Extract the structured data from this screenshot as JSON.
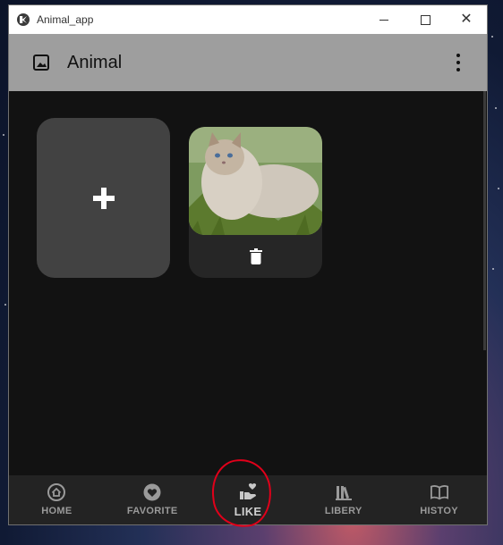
{
  "window": {
    "title": "Animal_app",
    "controls": {
      "minimize": "minimize",
      "maximize": "maximize",
      "close": "close"
    }
  },
  "appbar": {
    "icon": "image-icon",
    "title": "Animal",
    "menu_icon": "more-vert-icon"
  },
  "cards": {
    "add_card": {
      "icon": "plus-icon"
    },
    "photo_card": {
      "image": "cat-photo",
      "action_icon": "trash-icon"
    }
  },
  "bottom_nav": {
    "items": [
      {
        "label": "HOME",
        "icon": "home-icon"
      },
      {
        "label": "FAVORITE",
        "icon": "heart-icon"
      },
      {
        "label": "LIKE",
        "icon": "hand-heart-icon",
        "active": true
      },
      {
        "label": "LIBERY",
        "icon": "library-icon"
      },
      {
        "label": "HISTOY",
        "icon": "book-icon"
      }
    ]
  },
  "colors": {
    "appbar": "#9e9e9e",
    "background": "#121212",
    "card": "#424242",
    "nav": "#232323",
    "annotation": "#e0001a"
  }
}
